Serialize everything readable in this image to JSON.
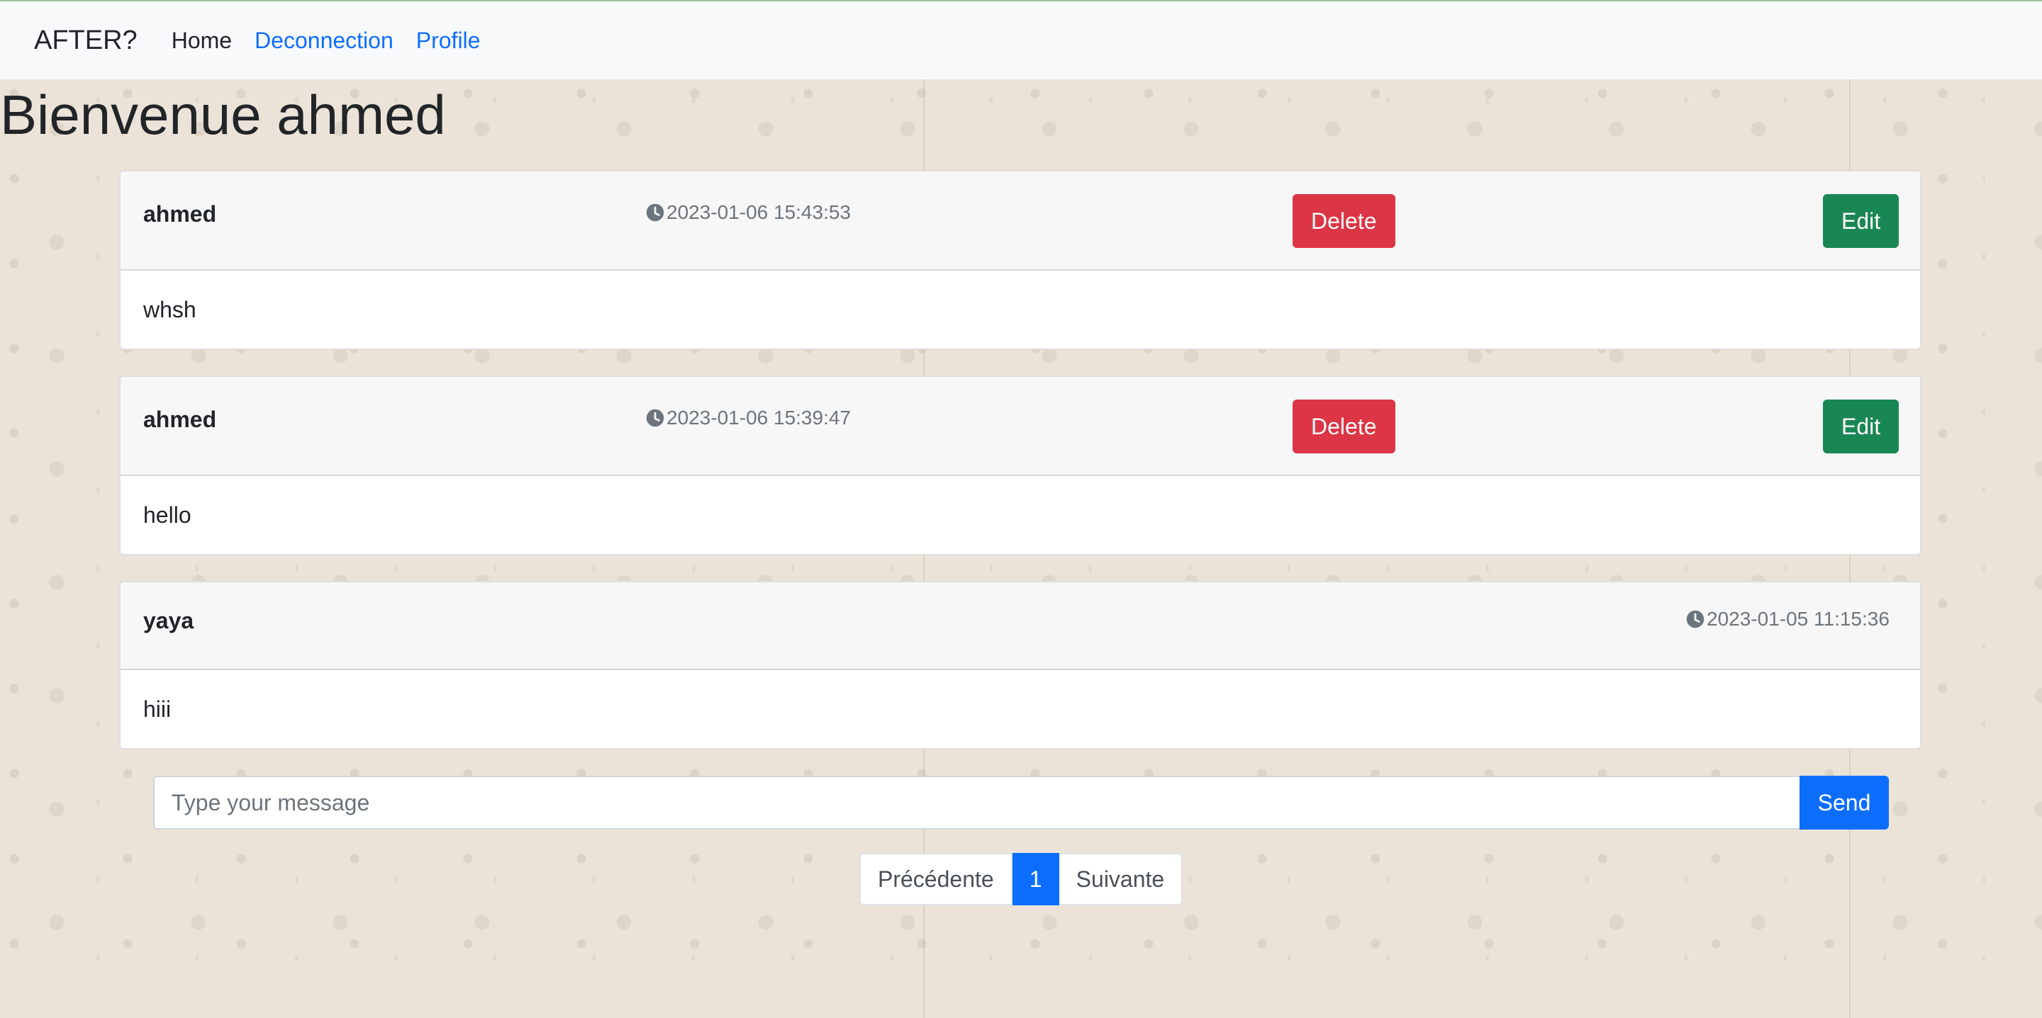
{
  "navbar": {
    "brand": "AFTER?",
    "links": [
      "Home",
      "Deconnection",
      "Profile"
    ]
  },
  "page": {
    "title": "Bienvenue ahmed"
  },
  "messages": [
    {
      "author": "ahmed",
      "timestamp": "2023-01-06 15:43:53",
      "text": "whsh",
      "delete_label": "Delete",
      "edit_label": "Edit"
    },
    {
      "author": "ahmed",
      "timestamp": "2023-01-06 15:39:47",
      "text": "hello",
      "delete_label": "Delete",
      "edit_label": "Edit"
    },
    {
      "author": "yaya",
      "timestamp": "2023-01-05 11:15:36",
      "text": "hiii"
    }
  ],
  "composer": {
    "placeholder": "Type your message",
    "value": "",
    "send_label": "Send"
  },
  "pagination": {
    "previous": "Précédente",
    "current": "1",
    "next": "Suivante"
  },
  "colors": {
    "primary": "#0d6efd",
    "danger": "#dc3545",
    "success": "#198754"
  }
}
